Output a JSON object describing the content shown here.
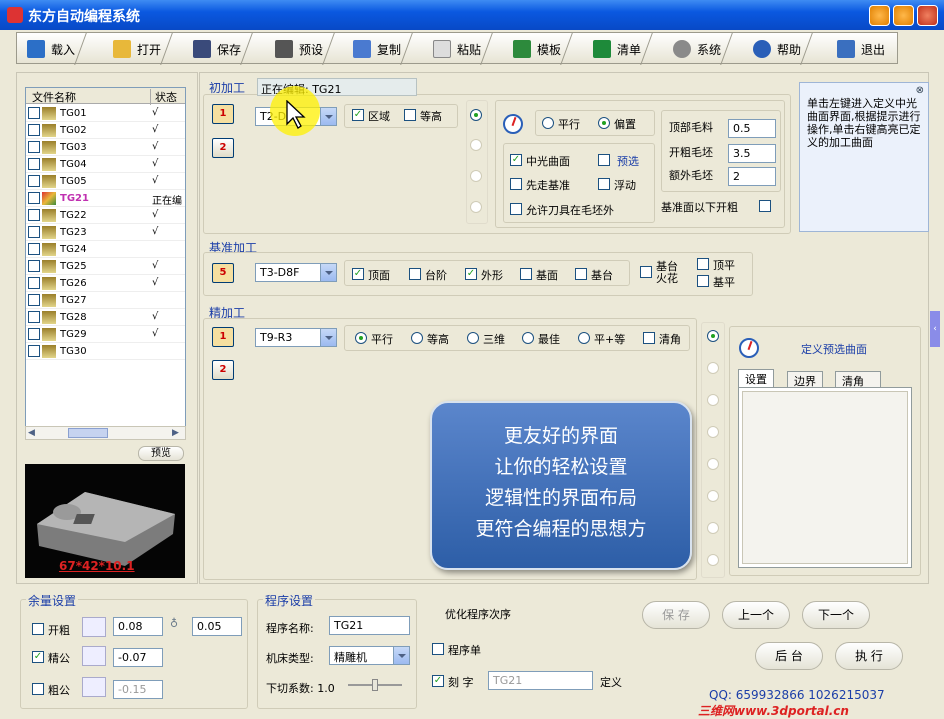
{
  "window": {
    "title": "东方自动编程系统"
  },
  "toolbar": {
    "items": [
      "载入",
      "打开",
      "保存",
      "预设",
      "复制",
      "粘贴",
      "模板",
      "清单",
      "系统",
      "帮助",
      "退出"
    ]
  },
  "filelist": {
    "headers": [
      "文件名称",
      "状态"
    ],
    "rows": [
      {
        "name": "TG01",
        "status": "√"
      },
      {
        "name": "TG02",
        "status": "√"
      },
      {
        "name": "TG03",
        "status": "√"
      },
      {
        "name": "TG04",
        "status": "√"
      },
      {
        "name": "TG05",
        "status": "√"
      },
      {
        "name": "TG21",
        "status": "正在编"
      },
      {
        "name": "TG22",
        "status": "√"
      },
      {
        "name": "TG23",
        "status": "√"
      },
      {
        "name": "TG24",
        "status": ""
      },
      {
        "name": "TG25",
        "status": "√"
      },
      {
        "name": "TG26",
        "status": "√"
      },
      {
        "name": "TG27",
        "status": ""
      },
      {
        "name": "TG28",
        "status": "√"
      },
      {
        "name": "TG29",
        "status": "√"
      },
      {
        "name": "TG30",
        "status": ""
      }
    ],
    "preview_button": "预览",
    "dims": "67*42*10.1"
  },
  "rough": {
    "label": "初加工",
    "editing": "正在编辑:  TG21",
    "tool": "T2-D1",
    "opt_area": "区域",
    "opt_contour": "等高",
    "mode_parallel": "平行",
    "mode_offset": "偏置",
    "opt_lightface": "中光曲面",
    "opt_preselect": "预选",
    "opt_firstbase": "先走基准",
    "opt_float": "浮动",
    "opt_allowout": "允许刀具在毛坯外",
    "top_blank_label": "顶部毛料",
    "top_blank": "0.5",
    "rough_blank_label": "开粗毛坯",
    "rough_blank": "3.5",
    "extra_blank_label": "额外毛坯",
    "extra_blank": "2",
    "below_base": "基准面以下开粗"
  },
  "base": {
    "label": "基准加工",
    "tool": "T3-D8F",
    "opts": [
      "顶面",
      "台阶",
      "外形",
      "基面",
      "基台"
    ],
    "opt_stand": "基台火花",
    "opt_top_flat": "顶平",
    "opt_base_flat": "基平"
  },
  "finish": {
    "label": "精加工",
    "tool": "T9-R3",
    "modes": [
      "平行",
      "等高",
      "三维",
      "最佳",
      "平+等"
    ],
    "opt_clear": "清角",
    "define_label": "定义预选曲面",
    "tabs": [
      "设置",
      "边界",
      "清角"
    ]
  },
  "hint": {
    "text": "单击左键进入定义中光曲面界面,根据提示进行操作,单击右键高亮已定义的加工曲面"
  },
  "popup": {
    "lines": [
      "更友好的界面",
      "让你的轻松设置",
      "逻辑性的界面布局",
      "更符合编程的思想方"
    ]
  },
  "allowance": {
    "label": "余量设置",
    "rows": [
      {
        "name": "开粗",
        "v1": "0.08",
        "v2": "0.05",
        "checked": false
      },
      {
        "name": "精公",
        "v1": "-0.07",
        "checked": true
      },
      {
        "name": "粗公",
        "v1": "-0.15",
        "checked": false
      }
    ]
  },
  "program": {
    "label": "程序设置",
    "name_label": "程序名称:",
    "name": "TG21",
    "machine_label": "机床类型:",
    "machine": "精雕机",
    "cut_label": "下切系数: 1.0"
  },
  "order": {
    "label": "优化程序次序",
    "opt_sheet": "程序单",
    "opt_engrave": "刻  字",
    "engrave_value": "TG21",
    "define": "定义"
  },
  "buttons": {
    "save": "保 存",
    "prev": "上一个",
    "next": "下一个",
    "background": "后 台",
    "execute": "执 行"
  },
  "footer": {
    "qq": "QQ: 659932866  1026215037",
    "watermark": "三维网www.3dportal.cn"
  },
  "colors": {
    "title": "#0a58e0",
    "accent": "#21a121"
  }
}
